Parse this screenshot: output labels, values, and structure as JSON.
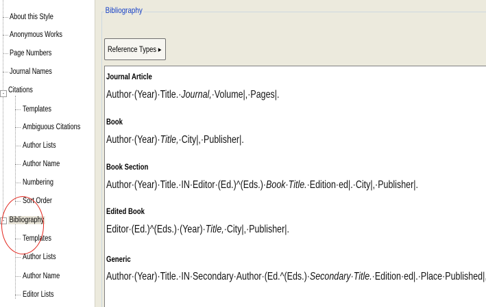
{
  "tree": {
    "items": [
      {
        "label": "About this Style"
      },
      {
        "label": "Anonymous Works"
      },
      {
        "label": "Page Numbers"
      },
      {
        "label": "Journal Names"
      },
      {
        "label": "Citations",
        "expander": "-"
      },
      {
        "label": "Templates"
      },
      {
        "label": "Ambiguous Citations"
      },
      {
        "label": "Author Lists"
      },
      {
        "label": "Author Name"
      },
      {
        "label": "Numbering"
      },
      {
        "label": "Sort Order"
      },
      {
        "label": "Bibliography",
        "expander": "-",
        "selected": true
      },
      {
        "label": "Templates"
      },
      {
        "label": "Author Lists"
      },
      {
        "label": "Author Name"
      },
      {
        "label": "Editor Lists"
      }
    ]
  },
  "panel": {
    "group_title": "Bibliography",
    "reference_types_button": "Reference Types",
    "reference_types_arrow": "▸"
  },
  "templates": [
    {
      "type": "Journal Article",
      "parts": [
        {
          "text": "Author·(Year)·Title.·"
        },
        {
          "text": "Journal,",
          "italic": true
        },
        {
          "text": "·Volume|,·Pages|."
        }
      ]
    },
    {
      "type": "Book",
      "parts": [
        {
          "text": "Author·(Year)·"
        },
        {
          "text": "Title,",
          "italic": true
        },
        {
          "text": "·City|,·Publisher|."
        }
      ]
    },
    {
      "type": "Book Section",
      "parts": [
        {
          "text": "Author·(Year)·Title.·IN·Editor·(Ed.)^(Eds.)·"
        },
        {
          "text": "Book·Title.",
          "italic": true
        },
        {
          "text": "·Edition·ed|.·City|,·Publisher|."
        }
      ]
    },
    {
      "type": "Edited Book",
      "parts": [
        {
          "text": "Editor·(Ed.)^(Eds.)·(Year)·"
        },
        {
          "text": "Title,",
          "italic": true
        },
        {
          "text": "·City|,·Publisher|."
        }
      ]
    },
    {
      "type": "Generic",
      "parts": [
        {
          "text": "Author·(Year)·Title.·IN·Secondary·Author·(Ed.^(Eds.)·"
        },
        {
          "text": "Secondary·Title.",
          "italic": true
        },
        {
          "text": "·Edition·ed|.·Place·Published|,"
        }
      ]
    }
  ]
}
